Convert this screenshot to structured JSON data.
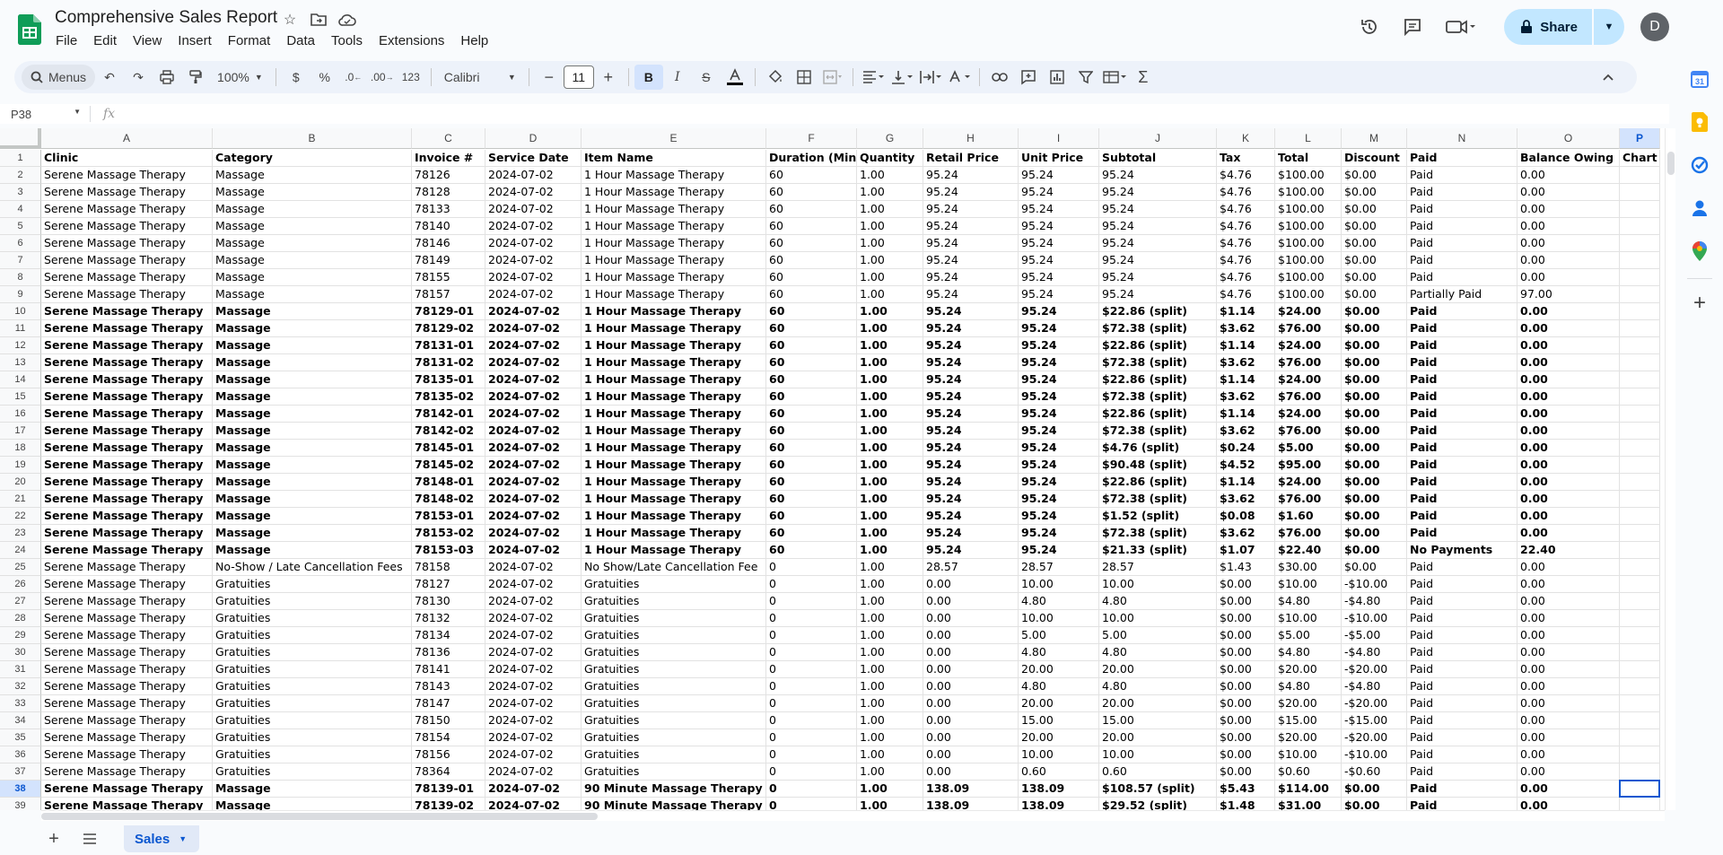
{
  "app": {
    "title": "Comprehensive Sales Report",
    "menus": [
      "File",
      "Edit",
      "View",
      "Insert",
      "Format",
      "Data",
      "Tools",
      "Extensions",
      "Help"
    ],
    "share_label": "Share",
    "avatar_letter": "D"
  },
  "toolbar": {
    "search_label": "Menus",
    "zoom": "100%",
    "currency": "$",
    "percent": "%",
    "decrease_decimal": ".0",
    "increase_decimal": ".00",
    "number_format": "123",
    "font": "Calibri",
    "font_size": "11"
  },
  "formula_bar": {
    "name_box": "P38",
    "fx": "fx"
  },
  "sheet": {
    "tab": "Sales",
    "columns": [
      "A",
      "B",
      "C",
      "D",
      "E",
      "F",
      "G",
      "H",
      "I",
      "J",
      "K",
      "L",
      "M",
      "N",
      "O",
      "P"
    ],
    "rows": [
      {
        "n": "1",
        "bold": true,
        "c": [
          "Clinic",
          "Category",
          "Invoice #",
          "Service Date",
          "Item Name",
          "Duration (Min)",
          "Quantity",
          "Retail Price",
          "Unit Price",
          "Subtotal",
          "Tax",
          "Total",
          "Discount",
          "Paid",
          "Balance Owing",
          "Chart #"
        ]
      },
      {
        "n": "2",
        "bold": false,
        "c": [
          "Serene Massage Therapy",
          "Massage",
          "78126",
          "2024-07-02",
          "1 Hour Massage Therapy",
          "60",
          "1.00",
          "95.24",
          "95.24",
          "95.24",
          "$4.76",
          "$100.00",
          "$0.00",
          "Paid",
          "0.00",
          ""
        ]
      },
      {
        "n": "3",
        "bold": false,
        "c": [
          "Serene Massage Therapy",
          "Massage",
          "78128",
          "2024-07-02",
          "1 Hour Massage Therapy",
          "60",
          "1.00",
          "95.24",
          "95.24",
          "95.24",
          "$4.76",
          "$100.00",
          "$0.00",
          "Paid",
          "0.00",
          ""
        ]
      },
      {
        "n": "4",
        "bold": false,
        "c": [
          "Serene Massage Therapy",
          "Massage",
          "78133",
          "2024-07-02",
          "1 Hour Massage Therapy",
          "60",
          "1.00",
          "95.24",
          "95.24",
          "95.24",
          "$4.76",
          "$100.00",
          "$0.00",
          "Paid",
          "0.00",
          ""
        ]
      },
      {
        "n": "5",
        "bold": false,
        "c": [
          "Serene Massage Therapy",
          "Massage",
          "78140",
          "2024-07-02",
          "1 Hour Massage Therapy",
          "60",
          "1.00",
          "95.24",
          "95.24",
          "95.24",
          "$4.76",
          "$100.00",
          "$0.00",
          "Paid",
          "0.00",
          ""
        ]
      },
      {
        "n": "6",
        "bold": false,
        "c": [
          "Serene Massage Therapy",
          "Massage",
          "78146",
          "2024-07-02",
          "1 Hour Massage Therapy",
          "60",
          "1.00",
          "95.24",
          "95.24",
          "95.24",
          "$4.76",
          "$100.00",
          "$0.00",
          "Paid",
          "0.00",
          ""
        ]
      },
      {
        "n": "7",
        "bold": false,
        "c": [
          "Serene Massage Therapy",
          "Massage",
          "78149",
          "2024-07-02",
          "1 Hour Massage Therapy",
          "60",
          "1.00",
          "95.24",
          "95.24",
          "95.24",
          "$4.76",
          "$100.00",
          "$0.00",
          "Paid",
          "0.00",
          ""
        ]
      },
      {
        "n": "8",
        "bold": false,
        "c": [
          "Serene Massage Therapy",
          "Massage",
          "78155",
          "2024-07-02",
          "1 Hour Massage Therapy",
          "60",
          "1.00",
          "95.24",
          "95.24",
          "95.24",
          "$4.76",
          "$100.00",
          "$0.00",
          "Paid",
          "0.00",
          ""
        ]
      },
      {
        "n": "9",
        "bold": false,
        "c": [
          "Serene Massage Therapy",
          "Massage",
          "78157",
          "2024-07-02",
          "1 Hour Massage Therapy",
          "60",
          "1.00",
          "95.24",
          "95.24",
          "95.24",
          "$4.76",
          "$100.00",
          "$0.00",
          "Partially Paid",
          "97.00",
          ""
        ]
      },
      {
        "n": "10",
        "bold": true,
        "c": [
          "Serene Massage Therapy",
          "Massage",
          "78129-01",
          "2024-07-02",
          "1 Hour Massage Therapy",
          "60",
          "1.00",
          "95.24",
          "95.24",
          "$22.86 (split)",
          "$1.14",
          "$24.00",
          "$0.00",
          "Paid",
          "0.00",
          ""
        ]
      },
      {
        "n": "11",
        "bold": true,
        "c": [
          "Serene Massage Therapy",
          "Massage",
          "78129-02",
          "2024-07-02",
          "1 Hour Massage Therapy",
          "60",
          "1.00",
          "95.24",
          "95.24",
          "$72.38 (split)",
          "$3.62",
          "$76.00",
          "$0.00",
          "Paid",
          "0.00",
          ""
        ]
      },
      {
        "n": "12",
        "bold": true,
        "c": [
          "Serene Massage Therapy",
          "Massage",
          "78131-01",
          "2024-07-02",
          "1 Hour Massage Therapy",
          "60",
          "1.00",
          "95.24",
          "95.24",
          "$22.86 (split)",
          "$1.14",
          "$24.00",
          "$0.00",
          "Paid",
          "0.00",
          ""
        ]
      },
      {
        "n": "13",
        "bold": true,
        "c": [
          "Serene Massage Therapy",
          "Massage",
          "78131-02",
          "2024-07-02",
          "1 Hour Massage Therapy",
          "60",
          "1.00",
          "95.24",
          "95.24",
          "$72.38 (split)",
          "$3.62",
          "$76.00",
          "$0.00",
          "Paid",
          "0.00",
          ""
        ]
      },
      {
        "n": "14",
        "bold": true,
        "c": [
          "Serene Massage Therapy",
          "Massage",
          "78135-01",
          "2024-07-02",
          "1 Hour Massage Therapy",
          "60",
          "1.00",
          "95.24",
          "95.24",
          "$22.86 (split)",
          "$1.14",
          "$24.00",
          "$0.00",
          "Paid",
          "0.00",
          ""
        ]
      },
      {
        "n": "15",
        "bold": true,
        "c": [
          "Serene Massage Therapy",
          "Massage",
          "78135-02",
          "2024-07-02",
          "1 Hour Massage Therapy",
          "60",
          "1.00",
          "95.24",
          "95.24",
          "$72.38 (split)",
          "$3.62",
          "$76.00",
          "$0.00",
          "Paid",
          "0.00",
          ""
        ]
      },
      {
        "n": "16",
        "bold": true,
        "c": [
          "Serene Massage Therapy",
          "Massage",
          "78142-01",
          "2024-07-02",
          "1 Hour Massage Therapy",
          "60",
          "1.00",
          "95.24",
          "95.24",
          "$22.86 (split)",
          "$1.14",
          "$24.00",
          "$0.00",
          "Paid",
          "0.00",
          ""
        ]
      },
      {
        "n": "17",
        "bold": true,
        "c": [
          "Serene Massage Therapy",
          "Massage",
          "78142-02",
          "2024-07-02",
          "1 Hour Massage Therapy",
          "60",
          "1.00",
          "95.24",
          "95.24",
          "$72.38 (split)",
          "$3.62",
          "$76.00",
          "$0.00",
          "Paid",
          "0.00",
          ""
        ]
      },
      {
        "n": "18",
        "bold": true,
        "c": [
          "Serene Massage Therapy",
          "Massage",
          "78145-01",
          "2024-07-02",
          "1 Hour Massage Therapy",
          "60",
          "1.00",
          "95.24",
          "95.24",
          "$4.76 (split)",
          "$0.24",
          "$5.00",
          "$0.00",
          "Paid",
          "0.00",
          ""
        ]
      },
      {
        "n": "19",
        "bold": true,
        "c": [
          "Serene Massage Therapy",
          "Massage",
          "78145-02",
          "2024-07-02",
          "1 Hour Massage Therapy",
          "60",
          "1.00",
          "95.24",
          "95.24",
          "$90.48 (split)",
          "$4.52",
          "$95.00",
          "$0.00",
          "Paid",
          "0.00",
          ""
        ]
      },
      {
        "n": "20",
        "bold": true,
        "c": [
          "Serene Massage Therapy",
          "Massage",
          "78148-01",
          "2024-07-02",
          "1 Hour Massage Therapy",
          "60",
          "1.00",
          "95.24",
          "95.24",
          "$22.86 (split)",
          "$1.14",
          "$24.00",
          "$0.00",
          "Paid",
          "0.00",
          ""
        ]
      },
      {
        "n": "21",
        "bold": true,
        "c": [
          "Serene Massage Therapy",
          "Massage",
          "78148-02",
          "2024-07-02",
          "1 Hour Massage Therapy",
          "60",
          "1.00",
          "95.24",
          "95.24",
          "$72.38 (split)",
          "$3.62",
          "$76.00",
          "$0.00",
          "Paid",
          "0.00",
          ""
        ]
      },
      {
        "n": "22",
        "bold": true,
        "c": [
          "Serene Massage Therapy",
          "Massage",
          "78153-01",
          "2024-07-02",
          "1 Hour Massage Therapy",
          "60",
          "1.00",
          "95.24",
          "95.24",
          "$1.52 (split)",
          "$0.08",
          "$1.60",
          "$0.00",
          "Paid",
          "0.00",
          ""
        ]
      },
      {
        "n": "23",
        "bold": true,
        "c": [
          "Serene Massage Therapy",
          "Massage",
          "78153-02",
          "2024-07-02",
          "1 Hour Massage Therapy",
          "60",
          "1.00",
          "95.24",
          "95.24",
          "$72.38 (split)",
          "$3.62",
          "$76.00",
          "$0.00",
          "Paid",
          "0.00",
          ""
        ]
      },
      {
        "n": "24",
        "bold": true,
        "c": [
          "Serene Massage Therapy",
          "Massage",
          "78153-03",
          "2024-07-02",
          "1 Hour Massage Therapy",
          "60",
          "1.00",
          "95.24",
          "95.24",
          "$21.33 (split)",
          "$1.07",
          "$22.40",
          "$0.00",
          "No Payments",
          "22.40",
          ""
        ]
      },
      {
        "n": "25",
        "bold": false,
        "c": [
          "Serene Massage Therapy",
          "No-Show / Late Cancellation Fees",
          "78158",
          "2024-07-02",
          "No Show/Late Cancellation Fee",
          "0",
          "1.00",
          "28.57",
          "28.57",
          "28.57",
          "$1.43",
          "$30.00",
          "$0.00",
          "Paid",
          "0.00",
          ""
        ]
      },
      {
        "n": "26",
        "bold": false,
        "c": [
          "Serene Massage Therapy",
          "Gratuities",
          "78127",
          "2024-07-02",
          "Gratuities",
          "0",
          "1.00",
          "0.00",
          "10.00",
          "10.00",
          "$0.00",
          "$10.00",
          "-$10.00",
          "Paid",
          "0.00",
          ""
        ]
      },
      {
        "n": "27",
        "bold": false,
        "c": [
          "Serene Massage Therapy",
          "Gratuities",
          "78130",
          "2024-07-02",
          "Gratuities",
          "0",
          "1.00",
          "0.00",
          "4.80",
          "4.80",
          "$0.00",
          "$4.80",
          "-$4.80",
          "Paid",
          "0.00",
          ""
        ]
      },
      {
        "n": "28",
        "bold": false,
        "c": [
          "Serene Massage Therapy",
          "Gratuities",
          "78132",
          "2024-07-02",
          "Gratuities",
          "0",
          "1.00",
          "0.00",
          "10.00",
          "10.00",
          "$0.00",
          "$10.00",
          "-$10.00",
          "Paid",
          "0.00",
          ""
        ]
      },
      {
        "n": "29",
        "bold": false,
        "c": [
          "Serene Massage Therapy",
          "Gratuities",
          "78134",
          "2024-07-02",
          "Gratuities",
          "0",
          "1.00",
          "0.00",
          "5.00",
          "5.00",
          "$0.00",
          "$5.00",
          "-$5.00",
          "Paid",
          "0.00",
          ""
        ]
      },
      {
        "n": "30",
        "bold": false,
        "c": [
          "Serene Massage Therapy",
          "Gratuities",
          "78136",
          "2024-07-02",
          "Gratuities",
          "0",
          "1.00",
          "0.00",
          "4.80",
          "4.80",
          "$0.00",
          "$4.80",
          "-$4.80",
          "Paid",
          "0.00",
          ""
        ]
      },
      {
        "n": "31",
        "bold": false,
        "c": [
          "Serene Massage Therapy",
          "Gratuities",
          "78141",
          "2024-07-02",
          "Gratuities",
          "0",
          "1.00",
          "0.00",
          "20.00",
          "20.00",
          "$0.00",
          "$20.00",
          "-$20.00",
          "Paid",
          "0.00",
          ""
        ]
      },
      {
        "n": "32",
        "bold": false,
        "c": [
          "Serene Massage Therapy",
          "Gratuities",
          "78143",
          "2024-07-02",
          "Gratuities",
          "0",
          "1.00",
          "0.00",
          "4.80",
          "4.80",
          "$0.00",
          "$4.80",
          "-$4.80",
          "Paid",
          "0.00",
          ""
        ]
      },
      {
        "n": "33",
        "bold": false,
        "c": [
          "Serene Massage Therapy",
          "Gratuities",
          "78147",
          "2024-07-02",
          "Gratuities",
          "0",
          "1.00",
          "0.00",
          "20.00",
          "20.00",
          "$0.00",
          "$20.00",
          "-$20.00",
          "Paid",
          "0.00",
          ""
        ]
      },
      {
        "n": "34",
        "bold": false,
        "c": [
          "Serene Massage Therapy",
          "Gratuities",
          "78150",
          "2024-07-02",
          "Gratuities",
          "0",
          "1.00",
          "0.00",
          "15.00",
          "15.00",
          "$0.00",
          "$15.00",
          "-$15.00",
          "Paid",
          "0.00",
          ""
        ]
      },
      {
        "n": "35",
        "bold": false,
        "c": [
          "Serene Massage Therapy",
          "Gratuities",
          "78154",
          "2024-07-02",
          "Gratuities",
          "0",
          "1.00",
          "0.00",
          "20.00",
          "20.00",
          "$0.00",
          "$20.00",
          "-$20.00",
          "Paid",
          "0.00",
          ""
        ]
      },
      {
        "n": "36",
        "bold": false,
        "c": [
          "Serene Massage Therapy",
          "Gratuities",
          "78156",
          "2024-07-02",
          "Gratuities",
          "0",
          "1.00",
          "0.00",
          "10.00",
          "10.00",
          "$0.00",
          "$10.00",
          "-$10.00",
          "Paid",
          "0.00",
          ""
        ]
      },
      {
        "n": "37",
        "bold": false,
        "c": [
          "Serene Massage Therapy",
          "Gratuities",
          "78364",
          "2024-07-02",
          "Gratuities",
          "0",
          "1.00",
          "0.00",
          "0.60",
          "0.60",
          "$0.00",
          "$0.60",
          "-$0.60",
          "Paid",
          "0.00",
          ""
        ]
      },
      {
        "n": "38",
        "bold": true,
        "c": [
          "Serene Massage Therapy",
          "Massage",
          "78139-01",
          "2024-07-02",
          "90 Minute Massage Therapy",
          "0",
          "1.00",
          "138.09",
          "138.09",
          "$108.57 (split)",
          "$5.43",
          "$114.00",
          "$0.00",
          "Paid",
          "0.00",
          ""
        ]
      },
      {
        "n": "39",
        "bold": true,
        "c": [
          "Serene Massage Therapy",
          "Massage",
          "78139-02",
          "2024-07-02",
          "90 Minute Massage Therapy",
          "0",
          "1.00",
          "138.09",
          "138.09",
          "$29.52 (split)",
          "$1.48",
          "$31.00",
          "$0.00",
          "Paid",
          "0.00",
          ""
        ]
      }
    ],
    "selected_row": "38",
    "selected_col": "P"
  }
}
